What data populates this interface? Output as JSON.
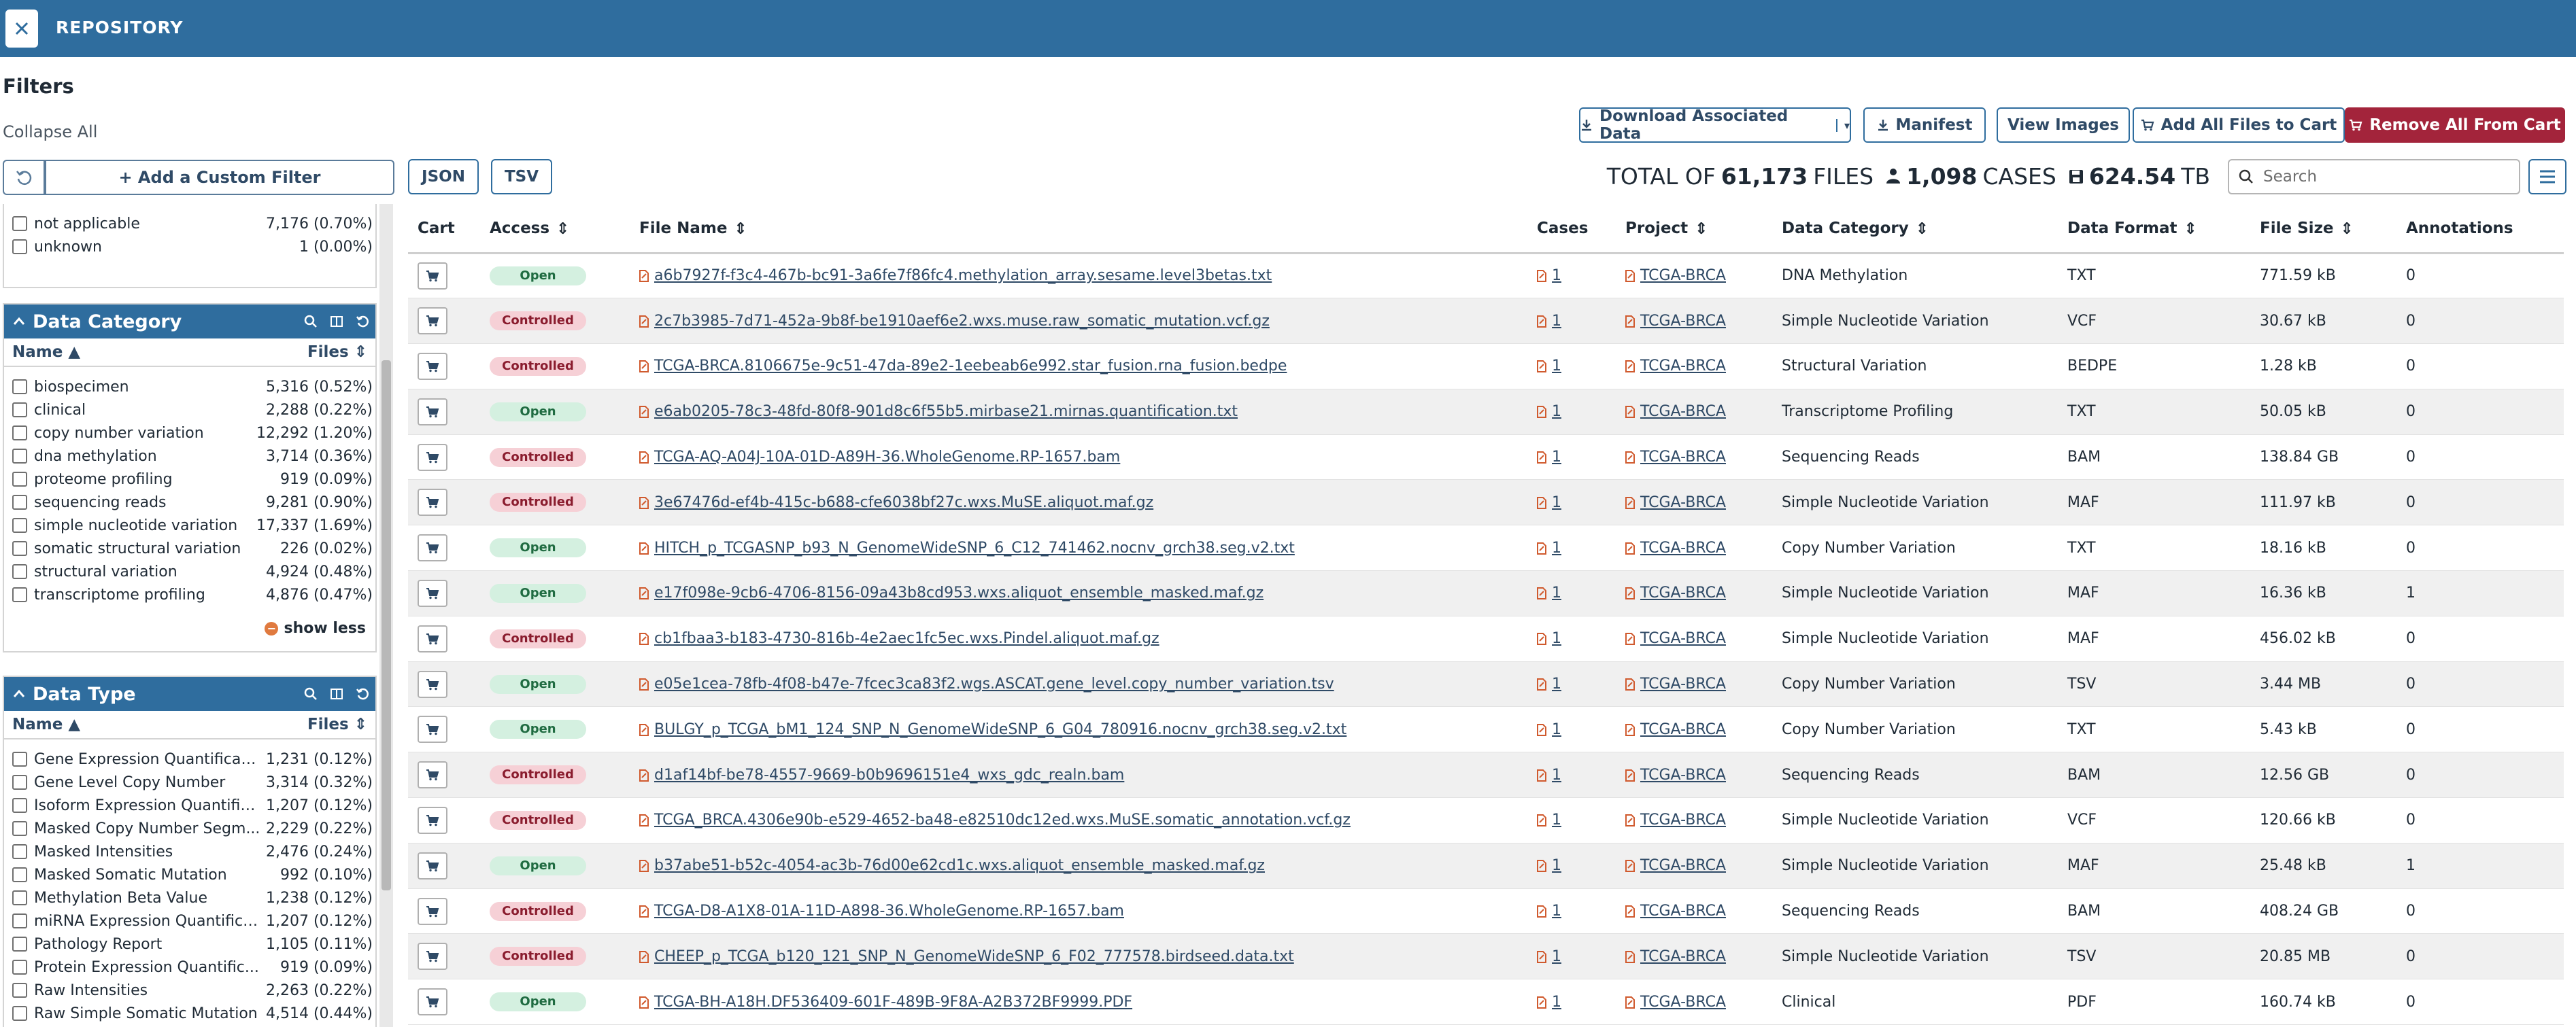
{
  "topbar": {
    "title": "REPOSITORY"
  },
  "filters": {
    "title": "Filters",
    "collapse_all": "Collapse All",
    "add_custom_filter": "+ Add a Custom Filter",
    "top_rows": [
      {
        "label": "not applicable",
        "count": "7,176 (0.70%)"
      },
      {
        "label": "unknown",
        "count": "1 (0.00%)"
      }
    ],
    "data_category": {
      "title": "Data Category",
      "name_col": "Name",
      "files_col": "Files",
      "items": [
        {
          "label": "biospecimen",
          "count": "5,316 (0.52%)"
        },
        {
          "label": "clinical",
          "count": "2,288 (0.22%)"
        },
        {
          "label": "copy number variation",
          "count": "12,292 (1.20%)"
        },
        {
          "label": "dna methylation",
          "count": "3,714 (0.36%)"
        },
        {
          "label": "proteome profiling",
          "count": "919 (0.09%)"
        },
        {
          "label": "sequencing reads",
          "count": "9,281 (0.90%)"
        },
        {
          "label": "simple nucleotide variation",
          "count": "17,337 (1.69%)"
        },
        {
          "label": "somatic structural variation",
          "count": "226 (0.02%)"
        },
        {
          "label": "structural variation",
          "count": "4,924 (0.48%)"
        },
        {
          "label": "transcriptome profiling",
          "count": "4,876 (0.47%)"
        }
      ],
      "show_less": "show less"
    },
    "data_type": {
      "title": "Data Type",
      "name_col": "Name",
      "files_col": "Files",
      "items": [
        {
          "label": "Gene Expression Quantificati...",
          "count": "1,231 (0.12%)"
        },
        {
          "label": "Gene Level Copy Number",
          "count": "3,314 (0.32%)"
        },
        {
          "label": "Isoform Expression Quantific...",
          "count": "1,207 (0.12%)"
        },
        {
          "label": "Masked Copy Number Segm...",
          "count": "2,229 (0.22%)"
        },
        {
          "label": "Masked Intensities",
          "count": "2,476 (0.24%)"
        },
        {
          "label": "Masked Somatic Mutation",
          "count": "992 (0.10%)"
        },
        {
          "label": "Methylation Beta Value",
          "count": "1,238 (0.12%)"
        },
        {
          "label": "miRNA Expression Quantificat...",
          "count": "1,207 (0.12%)"
        },
        {
          "label": "Pathology Report",
          "count": "1,105 (0.11%)"
        },
        {
          "label": "Protein Expression Quantific...",
          "count": "919 (0.09%)"
        },
        {
          "label": "Raw Intensities",
          "count": "2,263 (0.22%)"
        },
        {
          "label": "Raw Simple Somatic Mutation",
          "count": "4,514 (0.44%)"
        }
      ]
    }
  },
  "toolbar": {
    "json": "JSON",
    "tsv": "TSV",
    "download_associated": "Download Associated Data",
    "manifest": "Manifest",
    "view_images": "View Images",
    "add_all": "Add All Files to Cart",
    "remove_all": "Remove All From Cart"
  },
  "totals": {
    "prefix": "TOTAL OF",
    "files_count": "61,173",
    "files_label": "FILES",
    "cases_count": "1,098",
    "cases_label": "CASES",
    "size_value": "624.54",
    "size_unit": "TB"
  },
  "search": {
    "placeholder": "Search"
  },
  "table": {
    "columns": {
      "cart": "Cart",
      "access": "Access",
      "file_name": "File Name",
      "cases": "Cases",
      "project": "Project",
      "data_category": "Data Category",
      "data_format": "Data Format",
      "file_size": "File Size",
      "annotations": "Annotations"
    },
    "rows": [
      {
        "access": "Open",
        "file": "a6b7927f-f3c4-467b-bc91-3a6fe7f86fc4.methylation_array.sesame.level3betas.txt",
        "cases": "1",
        "project": "TCGA-BRCA",
        "category": "DNA Methylation",
        "format": "TXT",
        "size": "771.59 kB",
        "annotations": "0"
      },
      {
        "access": "Controlled",
        "file": "2c7b3985-7d71-452a-9b8f-be1910aef6e2.wxs.muse.raw_somatic_mutation.vcf.gz",
        "cases": "1",
        "project": "TCGA-BRCA",
        "category": "Simple Nucleotide Variation",
        "format": "VCF",
        "size": "30.67 kB",
        "annotations": "0"
      },
      {
        "access": "Controlled",
        "file": "TCGA-BRCA.8106675e-9c51-47da-89e2-1eebeab6e992.star_fusion.rna_fusion.bedpe",
        "cases": "1",
        "project": "TCGA-BRCA",
        "category": "Structural Variation",
        "format": "BEDPE",
        "size": "1.28 kB",
        "annotations": "0"
      },
      {
        "access": "Open",
        "file": "e6ab0205-78c3-48fd-80f8-901d8c6f55b5.mirbase21.mirnas.quantification.txt",
        "cases": "1",
        "project": "TCGA-BRCA",
        "category": "Transcriptome Profiling",
        "format": "TXT",
        "size": "50.05 kB",
        "annotations": "0"
      },
      {
        "access": "Controlled",
        "file": "TCGA-AQ-A04J-10A-01D-A89H-36.WholeGenome.RP-1657.bam",
        "cases": "1",
        "project": "TCGA-BRCA",
        "category": "Sequencing Reads",
        "format": "BAM",
        "size": "138.84 GB",
        "annotations": "0"
      },
      {
        "access": "Controlled",
        "file": "3e67476d-ef4b-415c-b688-cfe6038bf27c.wxs.MuSE.aliquot.maf.gz",
        "cases": "1",
        "project": "TCGA-BRCA",
        "category": "Simple Nucleotide Variation",
        "format": "MAF",
        "size": "111.97 kB",
        "annotations": "0"
      },
      {
        "access": "Open",
        "file": "HITCH_p_TCGASNP_b93_N_GenomeWideSNP_6_C12_741462.nocnv_grch38.seg.v2.txt",
        "cases": "1",
        "project": "TCGA-BRCA",
        "category": "Copy Number Variation",
        "format": "TXT",
        "size": "18.16 kB",
        "annotations": "0"
      },
      {
        "access": "Open",
        "file": "e17f098e-9cb6-4706-8156-09a43b8cd953.wxs.aliquot_ensemble_masked.maf.gz",
        "cases": "1",
        "project": "TCGA-BRCA",
        "category": "Simple Nucleotide Variation",
        "format": "MAF",
        "size": "16.36 kB",
        "annotations": "1"
      },
      {
        "access": "Controlled",
        "file": "cb1fbaa3-b183-4730-816b-4e2aec1fc5ec.wxs.Pindel.aliquot.maf.gz",
        "cases": "1",
        "project": "TCGA-BRCA",
        "category": "Simple Nucleotide Variation",
        "format": "MAF",
        "size": "456.02 kB",
        "annotations": "0"
      },
      {
        "access": "Open",
        "file": "e05e1cea-78fb-4f08-b47e-7fcec3ca83f2.wgs.ASCAT.gene_level.copy_number_variation.tsv",
        "cases": "1",
        "project": "TCGA-BRCA",
        "category": "Copy Number Variation",
        "format": "TSV",
        "size": "3.44 MB",
        "annotations": "0"
      },
      {
        "access": "Open",
        "file": "BULGY_p_TCGA_bM1_124_SNP_N_GenomeWideSNP_6_G04_780916.nocnv_grch38.seg.v2.txt",
        "cases": "1",
        "project": "TCGA-BRCA",
        "category": "Copy Number Variation",
        "format": "TXT",
        "size": "5.43 kB",
        "annotations": "0"
      },
      {
        "access": "Controlled",
        "file": "d1af14bf-be78-4557-9669-b0b9696151e4_wxs_gdc_realn.bam",
        "cases": "1",
        "project": "TCGA-BRCA",
        "category": "Sequencing Reads",
        "format": "BAM",
        "size": "12.56 GB",
        "annotations": "0"
      },
      {
        "access": "Controlled",
        "file": "TCGA_BRCA.4306e90b-e529-4652-ba48-e82510dc12ed.wxs.MuSE.somatic_annotation.vcf.gz",
        "cases": "1",
        "project": "TCGA-BRCA",
        "category": "Simple Nucleotide Variation",
        "format": "VCF",
        "size": "120.66 kB",
        "annotations": "0"
      },
      {
        "access": "Open",
        "file": "b37abe51-b52c-4054-ac3b-76d00e62cd1c.wxs.aliquot_ensemble_masked.maf.gz",
        "cases": "1",
        "project": "TCGA-BRCA",
        "category": "Simple Nucleotide Variation",
        "format": "MAF",
        "size": "25.48 kB",
        "annotations": "1"
      },
      {
        "access": "Controlled",
        "file": "TCGA-D8-A1X8-01A-11D-A898-36.WholeGenome.RP-1657.bam",
        "cases": "1",
        "project": "TCGA-BRCA",
        "category": "Sequencing Reads",
        "format": "BAM",
        "size": "408.24 GB",
        "annotations": "0"
      },
      {
        "access": "Controlled",
        "file": "CHEEP_p_TCGA_b120_121_SNP_N_GenomeWideSNP_6_F02_777578.birdseed.data.txt",
        "cases": "1",
        "project": "TCGA-BRCA",
        "category": "Simple Nucleotide Variation",
        "format": "TSV",
        "size": "20.85 MB",
        "annotations": "0"
      },
      {
        "access": "Open",
        "file": "TCGA-BH-A18H.DF536409-601F-489B-9F8A-A2B372BF9999.PDF",
        "cases": "1",
        "project": "TCGA-BRCA",
        "category": "Clinical",
        "format": "PDF",
        "size": "160.74 kB",
        "annotations": "0"
      }
    ]
  }
}
